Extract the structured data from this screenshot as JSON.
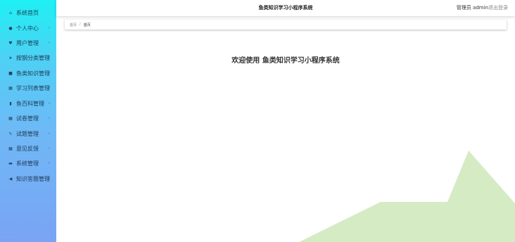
{
  "sidebar": {
    "items": [
      {
        "label": "系统首页",
        "icon": "home-icon",
        "glyph": "⌂",
        "has_submenu": false
      },
      {
        "label": "个人中心",
        "icon": "user-icon",
        "glyph": "●",
        "has_submenu": true
      },
      {
        "label": "用户管理",
        "icon": "users-icon",
        "glyph": "♥",
        "has_submenu": true
      },
      {
        "label": "按钢分类管理",
        "icon": "send-icon",
        "glyph": "➤",
        "has_submenu": true
      },
      {
        "label": "鱼类知识管理",
        "icon": "book-icon",
        "glyph": "■",
        "has_submenu": true
      },
      {
        "label": "学习列表管理",
        "icon": "grid-icon",
        "glyph": "▦",
        "has_submenu": true
      },
      {
        "label": "鱼百科管理",
        "icon": "chart-icon",
        "glyph": "▮",
        "has_submenu": true
      },
      {
        "label": "试卷管理",
        "icon": "grid-icon",
        "glyph": "▦",
        "has_submenu": true
      },
      {
        "label": "试题管理",
        "icon": "edit-icon",
        "glyph": "✎",
        "has_submenu": true
      },
      {
        "label": "意见反馈",
        "icon": "grid-icon",
        "glyph": "▦",
        "has_submenu": true
      },
      {
        "label": "系统管理",
        "icon": "monitor-icon",
        "glyph": "▬",
        "has_submenu": true
      },
      {
        "label": "知识答题管理",
        "icon": "speaker-icon",
        "glyph": "◀",
        "has_submenu": true
      }
    ],
    "chevron": "⌄"
  },
  "header": {
    "title": "鱼类知识学习小程序系统",
    "user": "管理员 admin",
    "logout": "退出登录"
  },
  "breadcrumb": {
    "home": "首页",
    "separator": "/",
    "current": "首页"
  },
  "main": {
    "welcome": "欢迎使用 鱼类知识学习小程序系统"
  },
  "colors": {
    "sidebar_top": "#1ef0f3",
    "sidebar_bottom": "#7aa3f4",
    "mountain": "#d5ebc4"
  }
}
